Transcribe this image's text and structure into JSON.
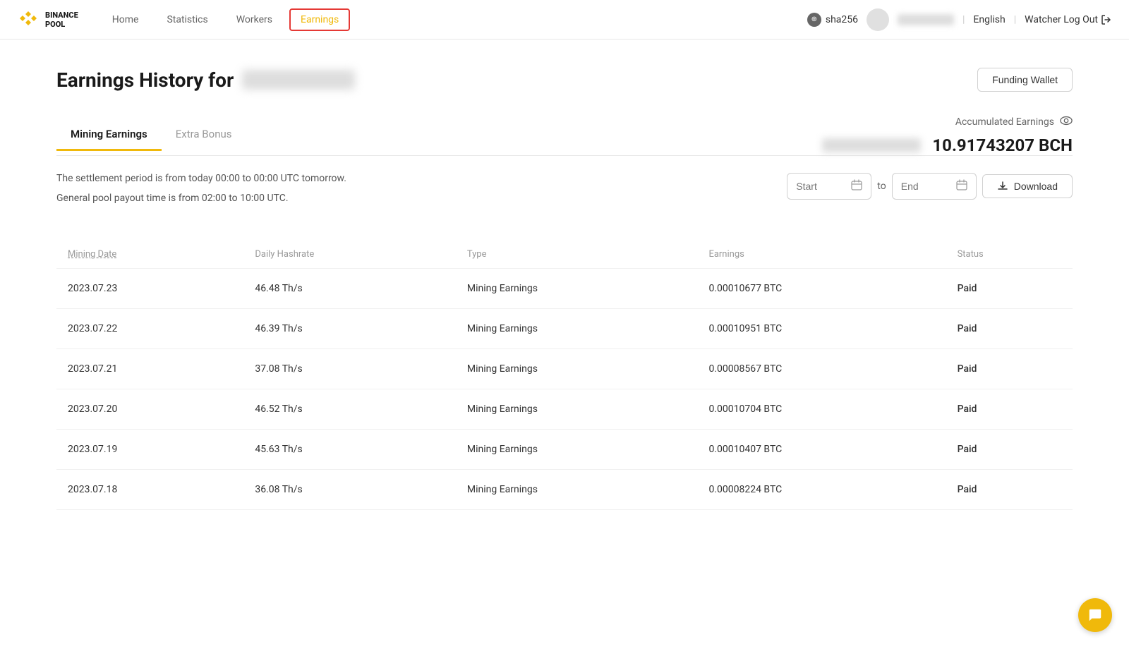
{
  "header": {
    "logo_text_line1": "BINANCE",
    "logo_text_line2": "POOL",
    "nav_items": [
      {
        "label": "Home",
        "active": false
      },
      {
        "label": "Statistics",
        "active": false
      },
      {
        "label": "Workers",
        "active": false
      },
      {
        "label": "Earnings",
        "active": true
      }
    ],
    "hash_algo": "sha256",
    "language": "English",
    "watcher_logout": "Watcher Log Out"
  },
  "page": {
    "title_prefix": "Earnings History for",
    "funding_wallet_btn": "Funding Wallet"
  },
  "tabs": {
    "items": [
      {
        "label": "Mining Earnings",
        "active": true
      },
      {
        "label": "Extra Bonus",
        "active": false
      }
    ]
  },
  "accumulated_earnings": {
    "label": "Accumulated Earnings",
    "amount": "10.91743207 BCH"
  },
  "info": {
    "settlement_text": "The settlement period is from today 00:00 to 00:00 UTC tomorrow.",
    "payout_text": "General pool payout time is from 02:00 to 10:00 UTC."
  },
  "date_filter": {
    "start_placeholder": "Start",
    "end_placeholder": "End",
    "to_label": "to",
    "download_btn": "Download"
  },
  "table": {
    "columns": [
      "Mining Date",
      "Daily Hashrate",
      "Type",
      "Earnings",
      "Status"
    ],
    "rows": [
      {
        "date": "2023.07.23",
        "hashrate": "46.48 Th/s",
        "type": "Mining Earnings",
        "earnings": "0.00010677 BTC",
        "status": "Paid"
      },
      {
        "date": "2023.07.22",
        "hashrate": "46.39 Th/s",
        "type": "Mining Earnings",
        "earnings": "0.00010951 BTC",
        "status": "Paid"
      },
      {
        "date": "2023.07.21",
        "hashrate": "37.08 Th/s",
        "type": "Mining Earnings",
        "earnings": "0.00008567 BTC",
        "status": "Paid"
      },
      {
        "date": "2023.07.20",
        "hashrate": "46.52 Th/s",
        "type": "Mining Earnings",
        "earnings": "0.00010704 BTC",
        "status": "Paid"
      },
      {
        "date": "2023.07.19",
        "hashrate": "45.63 Th/s",
        "type": "Mining Earnings",
        "earnings": "0.00010407 BTC",
        "status": "Paid"
      },
      {
        "date": "2023.07.18",
        "hashrate": "36.08 Th/s",
        "type": "Mining Earnings",
        "earnings": "0.00008224 BTC",
        "status": "Paid"
      }
    ]
  },
  "colors": {
    "active_tab_underline": "#f0b90b",
    "active_nav_border": "#e53935",
    "status_paid": "#02c076",
    "logo_orange": "#f0b90b"
  }
}
